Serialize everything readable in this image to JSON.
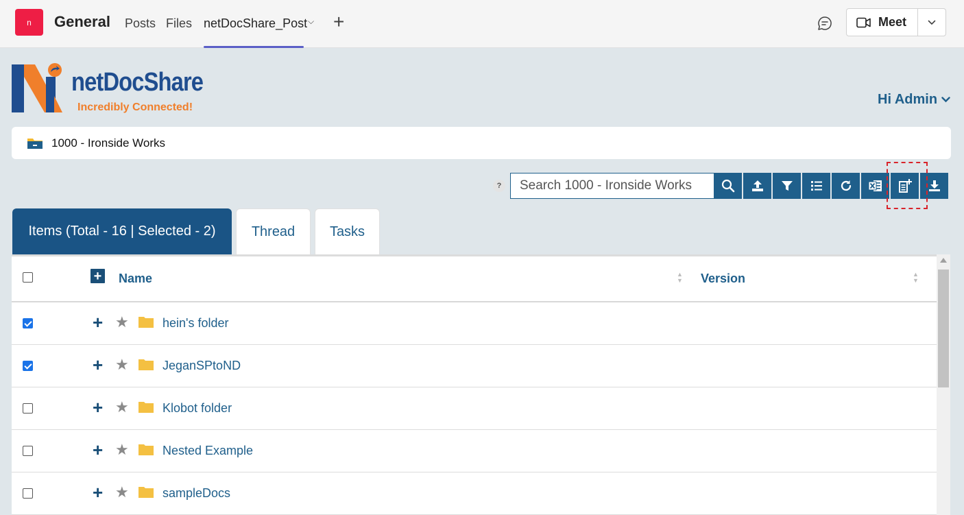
{
  "teams": {
    "team_initial": "n",
    "channel": "General",
    "tabs": [
      {
        "label": "Posts"
      },
      {
        "label": "Files"
      },
      {
        "label": "netDocShare_Post"
      }
    ],
    "meet_label": "Meet"
  },
  "app": {
    "brand": "netDocShare",
    "tagline": "Incredibly Connected!",
    "greeting": "Hi Admin",
    "breadcrumb": "1000 - Ironside Works",
    "help": "?",
    "search_placeholder": "Search 1000 - Ironside Works",
    "toolbar": [
      "search-icon",
      "upload-icon",
      "filter-icon",
      "list-view-icon",
      "refresh-icon",
      "excel-export-icon",
      "new-document-icon",
      "download-icon"
    ]
  },
  "panel_tabs": [
    {
      "label": "Items (Total - 16 | Selected - 2)"
    },
    {
      "label": "Thread"
    },
    {
      "label": "Tasks"
    }
  ],
  "grid": {
    "columns": {
      "name": "Name",
      "version": "Version"
    },
    "rows": [
      {
        "name": "hein's folder",
        "checked": true
      },
      {
        "name": "JeganSPtoND",
        "checked": true
      },
      {
        "name": "Klobot folder",
        "checked": false
      },
      {
        "name": "Nested Example",
        "checked": false
      },
      {
        "name": "sampleDocs",
        "checked": false
      }
    ]
  },
  "colors": {
    "primary": "#1f5f8b",
    "accent_teams": "#5b5fc7",
    "highlight": "#d8232a"
  }
}
